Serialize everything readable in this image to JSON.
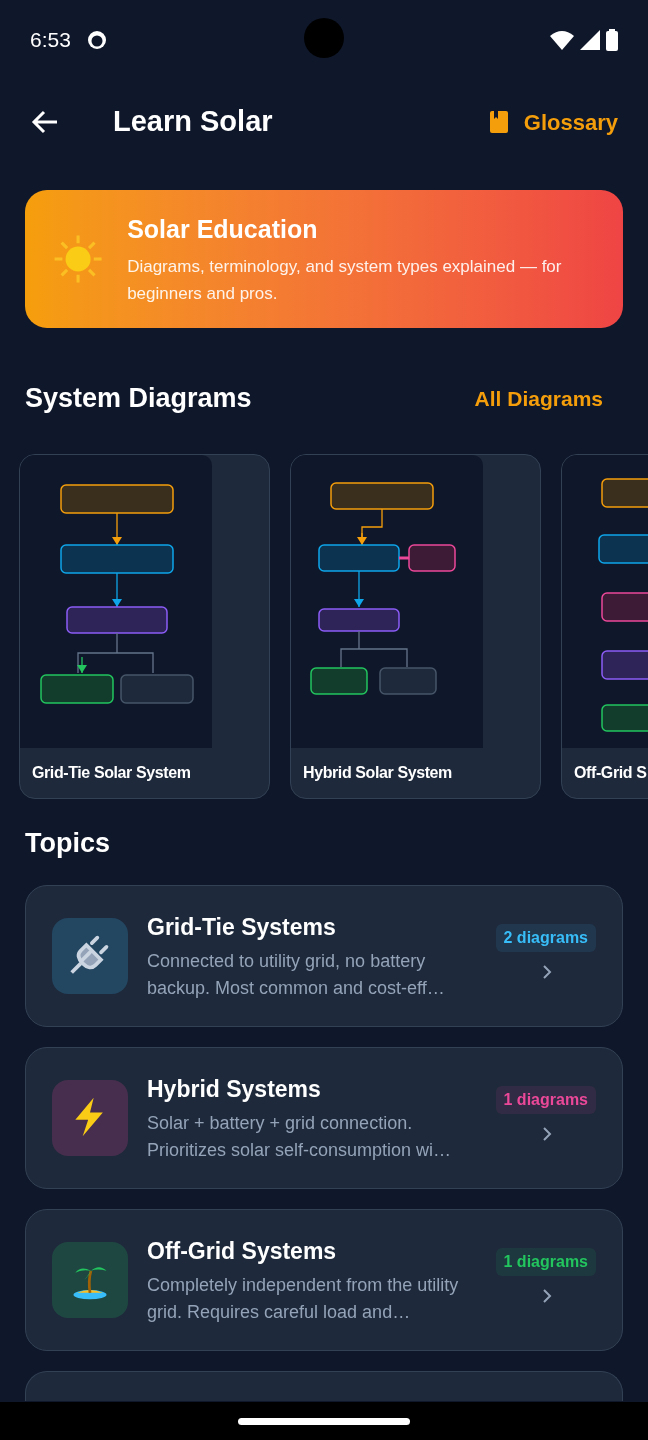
{
  "status_bar": {
    "time": "6:53"
  },
  "header": {
    "title": "Learn Solar",
    "glossary_label": "Glossary"
  },
  "hero": {
    "title": "Solar Education",
    "subtitle": "Diagrams, terminology, and system types explained — for beginners and pros."
  },
  "diagrams_section": {
    "title": "System Diagrams",
    "link": "All Diagrams",
    "cards": [
      {
        "kind": "grid-tie",
        "title": "Grid-Tie Solar System"
      },
      {
        "kind": "hybrid",
        "title": "Hybrid Solar System"
      },
      {
        "kind": "off-grid",
        "title": "Off-Grid S"
      }
    ]
  },
  "topics_section": {
    "title": "Topics",
    "topics": [
      {
        "kind": "plug",
        "title": "Grid-Tie Systems",
        "description": "Connected to utility grid, no battery backup. Most common and cost-eff…",
        "badge": "2 diagrams",
        "color": "#38bdf8"
      },
      {
        "kind": "bolt",
        "title": "Hybrid Systems",
        "description": "Solar + battery + grid connection. Prioritizes solar self-consumption wi…",
        "badge": "1 diagrams",
        "color": "#ec4899"
      },
      {
        "kind": "island",
        "title": "Off-Grid Systems",
        "description": "Completely independent from the utility grid. Requires careful load and…",
        "badge": "1 diagrams",
        "color": "#22c55e"
      }
    ]
  }
}
